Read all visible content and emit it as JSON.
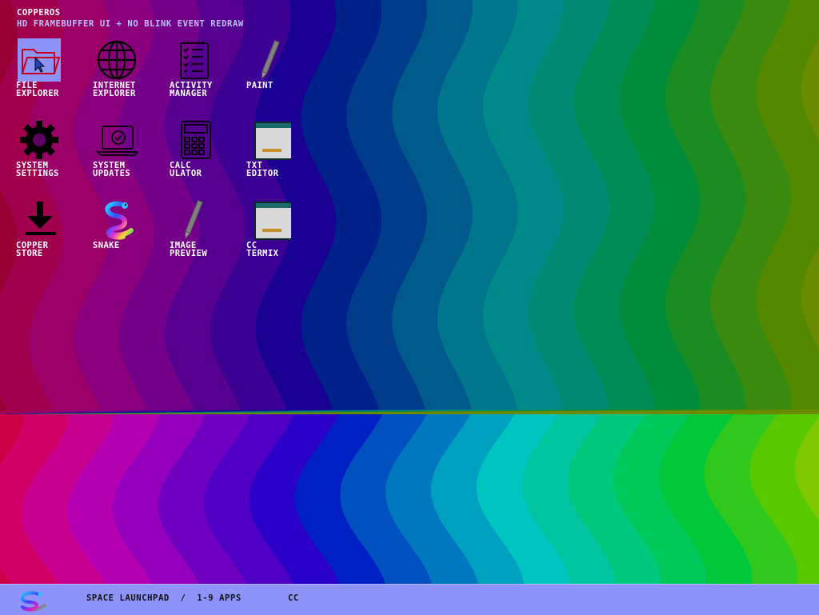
{
  "desktop": {
    "title": "COPPEROS",
    "subtitle": "HD FRAMEBUFFER UI + NO BLINK EVENT REDRAW"
  },
  "icons": [
    {
      "label": "FILE\nEXPLORER",
      "icon": "folder-icon",
      "selected": true
    },
    {
      "label": "INTERNET\nEXPLORER",
      "icon": "globe-icon",
      "selected": false
    },
    {
      "label": "ACTIVITY\nMANAGER",
      "icon": "checklist-icon",
      "selected": false
    },
    {
      "label": "PAINT",
      "icon": "pen-icon",
      "selected": false
    },
    {
      "label": "SYSTEM\nSETTINGS",
      "icon": "gear-icon",
      "selected": false
    },
    {
      "label": "SYSTEM\nUPDATES",
      "icon": "laptop-check-icon",
      "selected": false
    },
    {
      "label": "CALC\nULATOR",
      "icon": "calculator-icon",
      "selected": false
    },
    {
      "label": "TXT\nEDITOR",
      "icon": "window-icon",
      "selected": false
    },
    {
      "label": "COPPER\nSTORE",
      "icon": "download-icon",
      "selected": false
    },
    {
      "label": "SNAKE",
      "icon": "snake-icon",
      "selected": false
    },
    {
      "label": "IMAGE\nPREVIEW",
      "icon": "pen-icon",
      "selected": false
    },
    {
      "label": "CC\nTERMIX",
      "icon": "window-icon",
      "selected": false
    }
  ],
  "taskbar": {
    "logo_icon": "snake-logo-icon",
    "title": "SPACE LAUNCHPAD  /  1-9 APPS",
    "tray": "CC"
  },
  "colors": {
    "taskbar": "#8e93f7",
    "selection": "#8e93f7",
    "subtitle": "#b8c4ff",
    "wallpaper_upper": [
      "#880022",
      "#960033",
      "#a0004c",
      "#9a0066",
      "#8a007c",
      "#74008a",
      "#560090",
      "#3c0092",
      "#1a0092",
      "#00208a",
      "#003c8a",
      "#005a8c",
      "#00768c",
      "#008a8a",
      "#008c74",
      "#008c56",
      "#008c3a",
      "#1a8c22",
      "#3a8a10",
      "#548800",
      "#6a8a00"
    ],
    "wallpaper_lower": [
      "#c8002c",
      "#cc0044",
      "#d00066",
      "#c80090",
      "#b400b0",
      "#9400bc",
      "#7000c0",
      "#5000c4",
      "#2c00c8",
      "#0020c4",
      "#0050c0",
      "#0078c0",
      "#00a0c0",
      "#00c4c0",
      "#00c4a0",
      "#00c87c",
      "#00c85a",
      "#00c83a",
      "#30c81c",
      "#58c800",
      "#80c800"
    ]
  }
}
